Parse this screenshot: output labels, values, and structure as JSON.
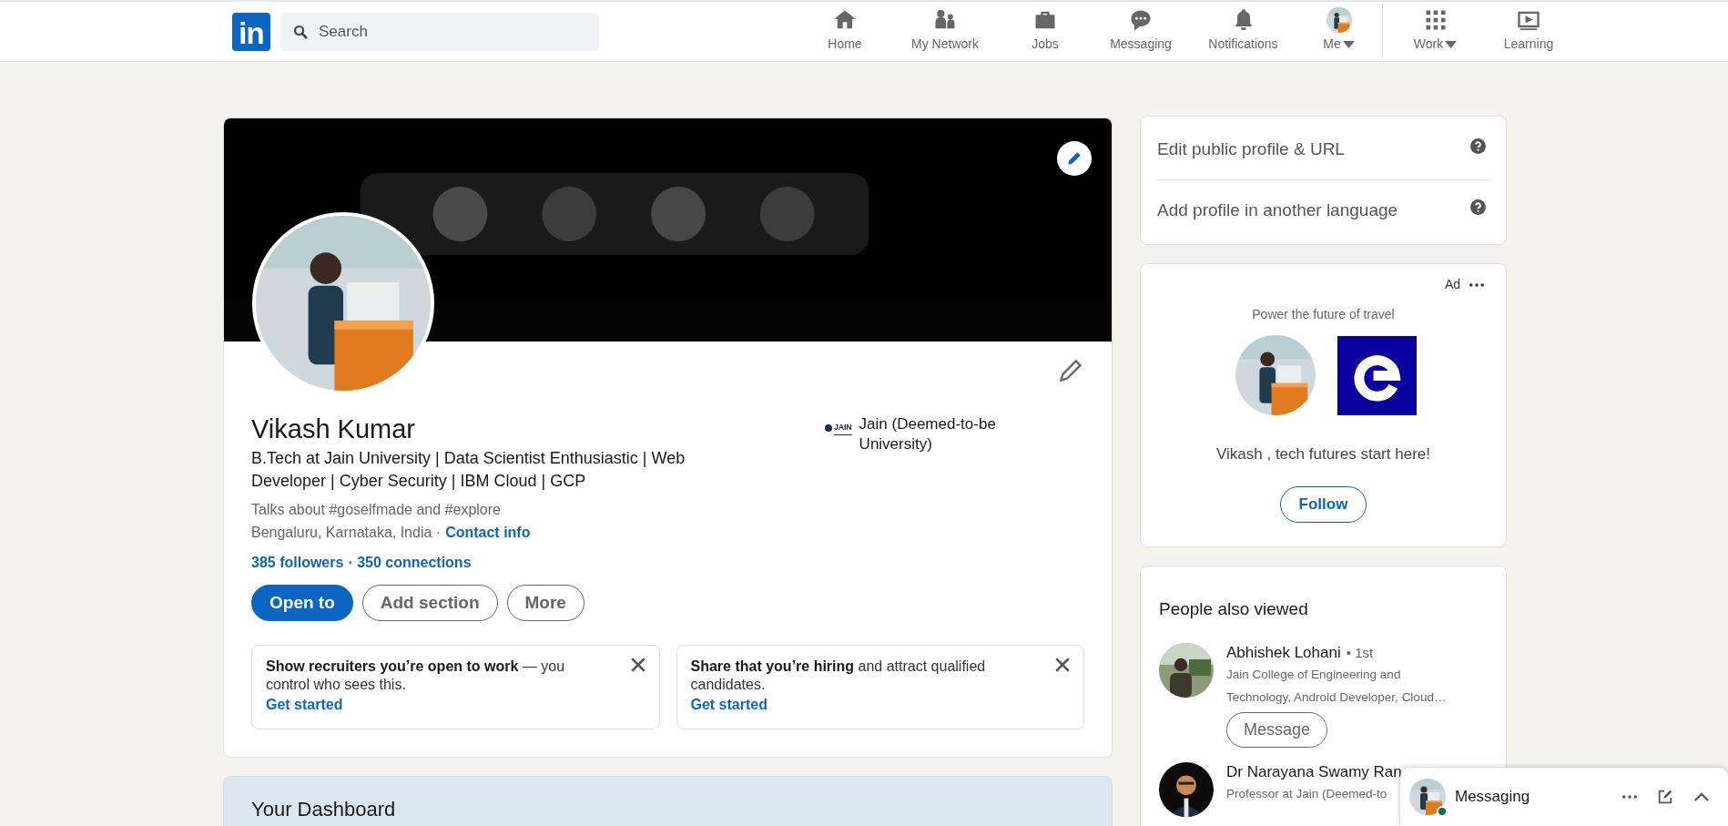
{
  "nav": {
    "logo": "in",
    "search": {
      "placeholder": "Search"
    },
    "items": [
      {
        "kind": "home",
        "label": "Home",
        "selected": false,
        "has_menu": false
      },
      {
        "kind": "network",
        "label": "My Network",
        "selected": false,
        "has_menu": false
      },
      {
        "kind": "jobs",
        "label": "Jobs",
        "selected": false,
        "has_menu": false
      },
      {
        "kind": "messaging",
        "label": "Messaging",
        "selected": false,
        "has_menu": false
      },
      {
        "kind": "notifications",
        "label": "Notifications",
        "selected": false,
        "has_menu": false
      },
      {
        "kind": "me",
        "label": "Me",
        "selected": false,
        "has_menu": true
      },
      {
        "kind": "work",
        "label": "Work",
        "selected": false,
        "has_menu": true
      },
      {
        "kind": "learning",
        "label": "Learning",
        "selected": false,
        "has_menu": false
      }
    ]
  },
  "profile": {
    "name": "Vikash Kumar",
    "headline": "B.Tech at Jain University | Data Scientist Enthusiastic | Web Developer | Cyber Security | IBM Cloud | GCP",
    "talks": "Talks about #goselfmade and #explore",
    "location": "Bengaluru, Karnataka, India ·",
    "contact_link": "Contact info",
    "followers": "385 followers",
    "connections": "· 350 connections",
    "education": {
      "logo_text": "JAIN",
      "name": "Jain (Deemed-to-be University)"
    },
    "buttons": [
      {
        "label": "Open to",
        "kind": "primary"
      },
      {
        "label": "Add section",
        "kind": "outline"
      },
      {
        "label": "More",
        "kind": "outline"
      }
    ],
    "promos": [
      {
        "text": "**Show recruiters you’re open to work** — you control who sees this.",
        "link": "Get started"
      },
      {
        "text": "**Share that you’re hiring** and attract qualified candidates.",
        "link": "Get started"
      }
    ]
  },
  "dashboard": {
    "title": "Your Dashboard"
  },
  "profile_links": [
    {
      "label": "Edit public profile & URL"
    },
    {
      "label": "Add profile in another language"
    }
  ],
  "ad": {
    "label": "Ad",
    "tagline": "Power the future of travel",
    "message": "Vikash , tech futures start here!",
    "button": "Follow"
  },
  "people_also_viewed": {
    "title": "People also viewed",
    "people": [
      {
        "name": "Abhishek Lohani",
        "degree": "• 1st",
        "headline": "Jain College of Engineering and Technology, Android Developer, Cloud…",
        "button": "Message"
      },
      {
        "name": "Dr Narayana Swamy Ran",
        "headline": "Professor at Jain (Deemed-to"
      }
    ]
  },
  "messaging_widget": {
    "title": "Messaging",
    "online": true
  }
}
